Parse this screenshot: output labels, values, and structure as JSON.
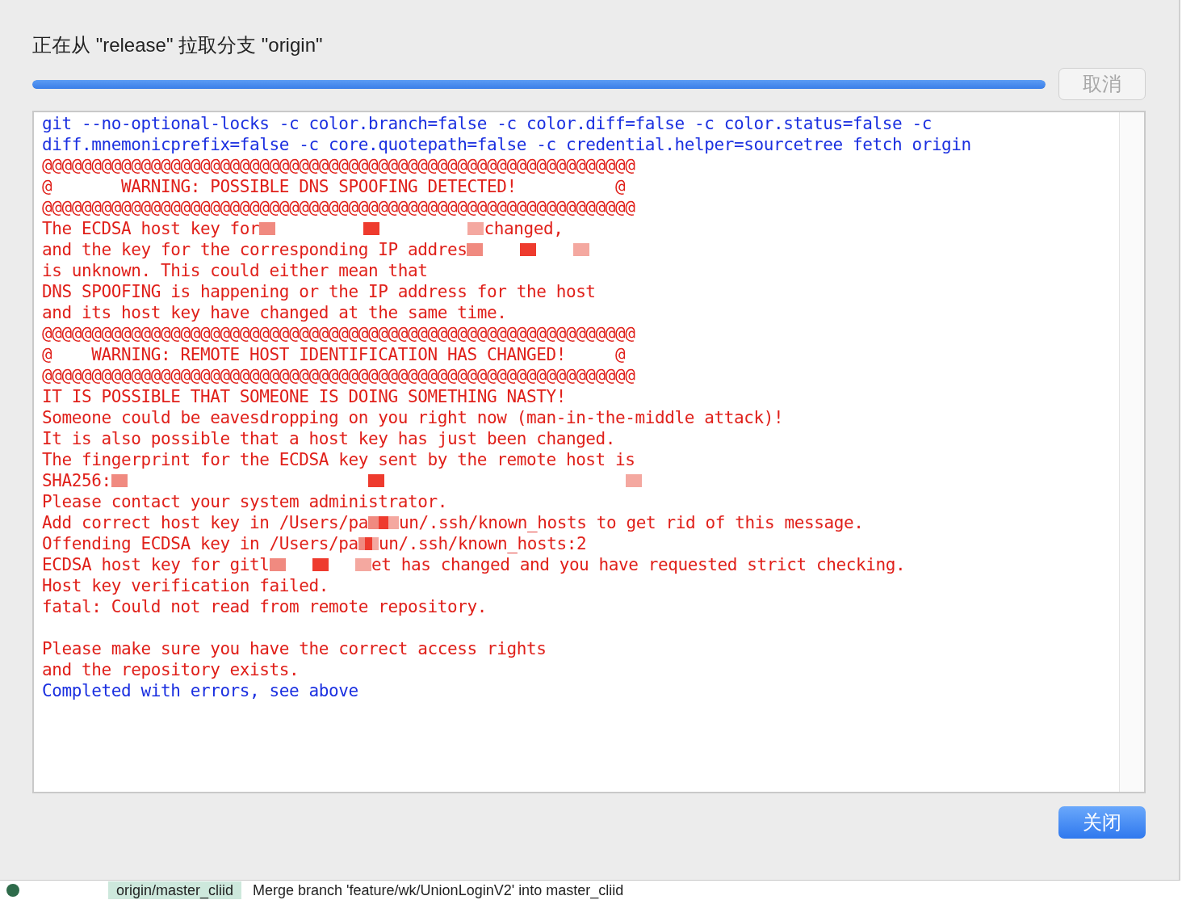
{
  "dialog": {
    "title": "正在从 \"release\" 拉取分支 \"origin\"",
    "progress": {
      "level": 1
    },
    "cancel_button": {
      "label": "取消",
      "disabled": true
    },
    "log": [
      {
        "kind": "command",
        "parts": [
          {
            "kind": "text",
            "text": "git --no-optional-locks -c color.branch=false -c color.diff=false -c color.status=false -c"
          }
        ]
      },
      {
        "kind": "command",
        "parts": [
          {
            "kind": "text",
            "text": "diff.mnemonicprefix=false -c core.quotepath=false -c credential.helper=sourcetree fetch origin"
          }
        ]
      },
      {
        "kind": "error",
        "parts": [
          {
            "kind": "text",
            "text": "@@@@@@@@@@@@@@@@@@@@@@@@@@@@@@@@@@@@@@@@@@@@@@@@@@@@@@@@@@@@"
          }
        ]
      },
      {
        "kind": "error",
        "parts": [
          {
            "kind": "text",
            "text": "@       WARNING: POSSIBLE DNS SPOOFING DETECTED!          @"
          }
        ]
      },
      {
        "kind": "error",
        "parts": [
          {
            "kind": "text",
            "text": "@@@@@@@@@@@@@@@@@@@@@@@@@@@@@@@@@@@@@@@@@@@@@@@@@@@@@@@@@@@@"
          }
        ]
      },
      {
        "kind": "error",
        "parts": [
          {
            "kind": "text",
            "text": "The ECDSA host key for"
          },
          {
            "kind": "redaction"
          },
          {
            "kind": "text",
            "text": "changed,"
          }
        ]
      },
      {
        "kind": "error",
        "parts": [
          {
            "kind": "text",
            "text": "and the key for the corresponding IP addres"
          },
          {
            "kind": "redaction"
          }
        ]
      },
      {
        "kind": "error",
        "parts": [
          {
            "kind": "text",
            "text": "is unknown. This could either mean that"
          }
        ]
      },
      {
        "kind": "error",
        "parts": [
          {
            "kind": "text",
            "text": "DNS SPOOFING is happening or the IP address for the host"
          }
        ]
      },
      {
        "kind": "error",
        "parts": [
          {
            "kind": "text",
            "text": "and its host key have changed at the same time."
          }
        ]
      },
      {
        "kind": "error",
        "parts": [
          {
            "kind": "text",
            "text": "@@@@@@@@@@@@@@@@@@@@@@@@@@@@@@@@@@@@@@@@@@@@@@@@@@@@@@@@@@@@"
          }
        ]
      },
      {
        "kind": "error",
        "parts": [
          {
            "kind": "text",
            "text": "@    WARNING: REMOTE HOST IDENTIFICATION HAS CHANGED!     @"
          }
        ]
      },
      {
        "kind": "error",
        "parts": [
          {
            "kind": "text",
            "text": "@@@@@@@@@@@@@@@@@@@@@@@@@@@@@@@@@@@@@@@@@@@@@@@@@@@@@@@@@@@@"
          }
        ]
      },
      {
        "kind": "error",
        "parts": [
          {
            "kind": "text",
            "text": "IT IS POSSIBLE THAT SOMEONE IS DOING SOMETHING NASTY!"
          }
        ]
      },
      {
        "kind": "error",
        "parts": [
          {
            "kind": "text",
            "text": "Someone could be eavesdropping on you right now (man-in-the-middle attack)!"
          }
        ]
      },
      {
        "kind": "error",
        "parts": [
          {
            "kind": "text",
            "text": "It is also possible that a host key has just been changed."
          }
        ]
      },
      {
        "kind": "error",
        "parts": [
          {
            "kind": "text",
            "text": "The fingerprint for the ECDSA key sent by the remote host is"
          }
        ]
      },
      {
        "kind": "error",
        "parts": [
          {
            "kind": "text",
            "text": "SHA256:"
          },
          {
            "kind": "redaction"
          }
        ]
      },
      {
        "kind": "error",
        "parts": [
          {
            "kind": "text",
            "text": "Please contact your system administrator."
          }
        ]
      },
      {
        "kind": "error",
        "parts": [
          {
            "kind": "text",
            "text": "Add correct host key in /Users/pa"
          },
          {
            "kind": "redaction"
          },
          {
            "kind": "text",
            "text": "un/.ssh/known_hosts to get rid of this message."
          }
        ]
      },
      {
        "kind": "error",
        "parts": [
          {
            "kind": "text",
            "text": "Offending ECDSA key in /Users/pa"
          },
          {
            "kind": "redaction"
          },
          {
            "kind": "text",
            "text": "un/.ssh/known_hosts:2"
          }
        ]
      },
      {
        "kind": "error",
        "parts": [
          {
            "kind": "text",
            "text": "ECDSA host key for gitl"
          },
          {
            "kind": "redaction"
          },
          {
            "kind": "text",
            "text": "et has changed and you have requested strict checking."
          }
        ]
      },
      {
        "kind": "error",
        "parts": [
          {
            "kind": "text",
            "text": "Host key verification failed."
          }
        ]
      },
      {
        "kind": "error",
        "parts": [
          {
            "kind": "text",
            "text": "fatal: Could not read from remote repository."
          }
        ]
      },
      {
        "kind": "blank"
      },
      {
        "kind": "error",
        "parts": [
          {
            "kind": "text",
            "text": "Please make sure you have the correct access rights"
          }
        ]
      },
      {
        "kind": "error",
        "parts": [
          {
            "kind": "text",
            "text": "and the repository exists."
          }
        ]
      },
      {
        "kind": "status",
        "parts": [
          {
            "kind": "text",
            "text": "Completed with errors, see above"
          }
        ]
      }
    ],
    "close_button": {
      "label": "关闭"
    }
  },
  "background_row": {
    "branch_tag": "origin/master_cliid",
    "message": "Merge branch 'feature/wk/UnionLoginV2' into master_cliid"
  }
}
